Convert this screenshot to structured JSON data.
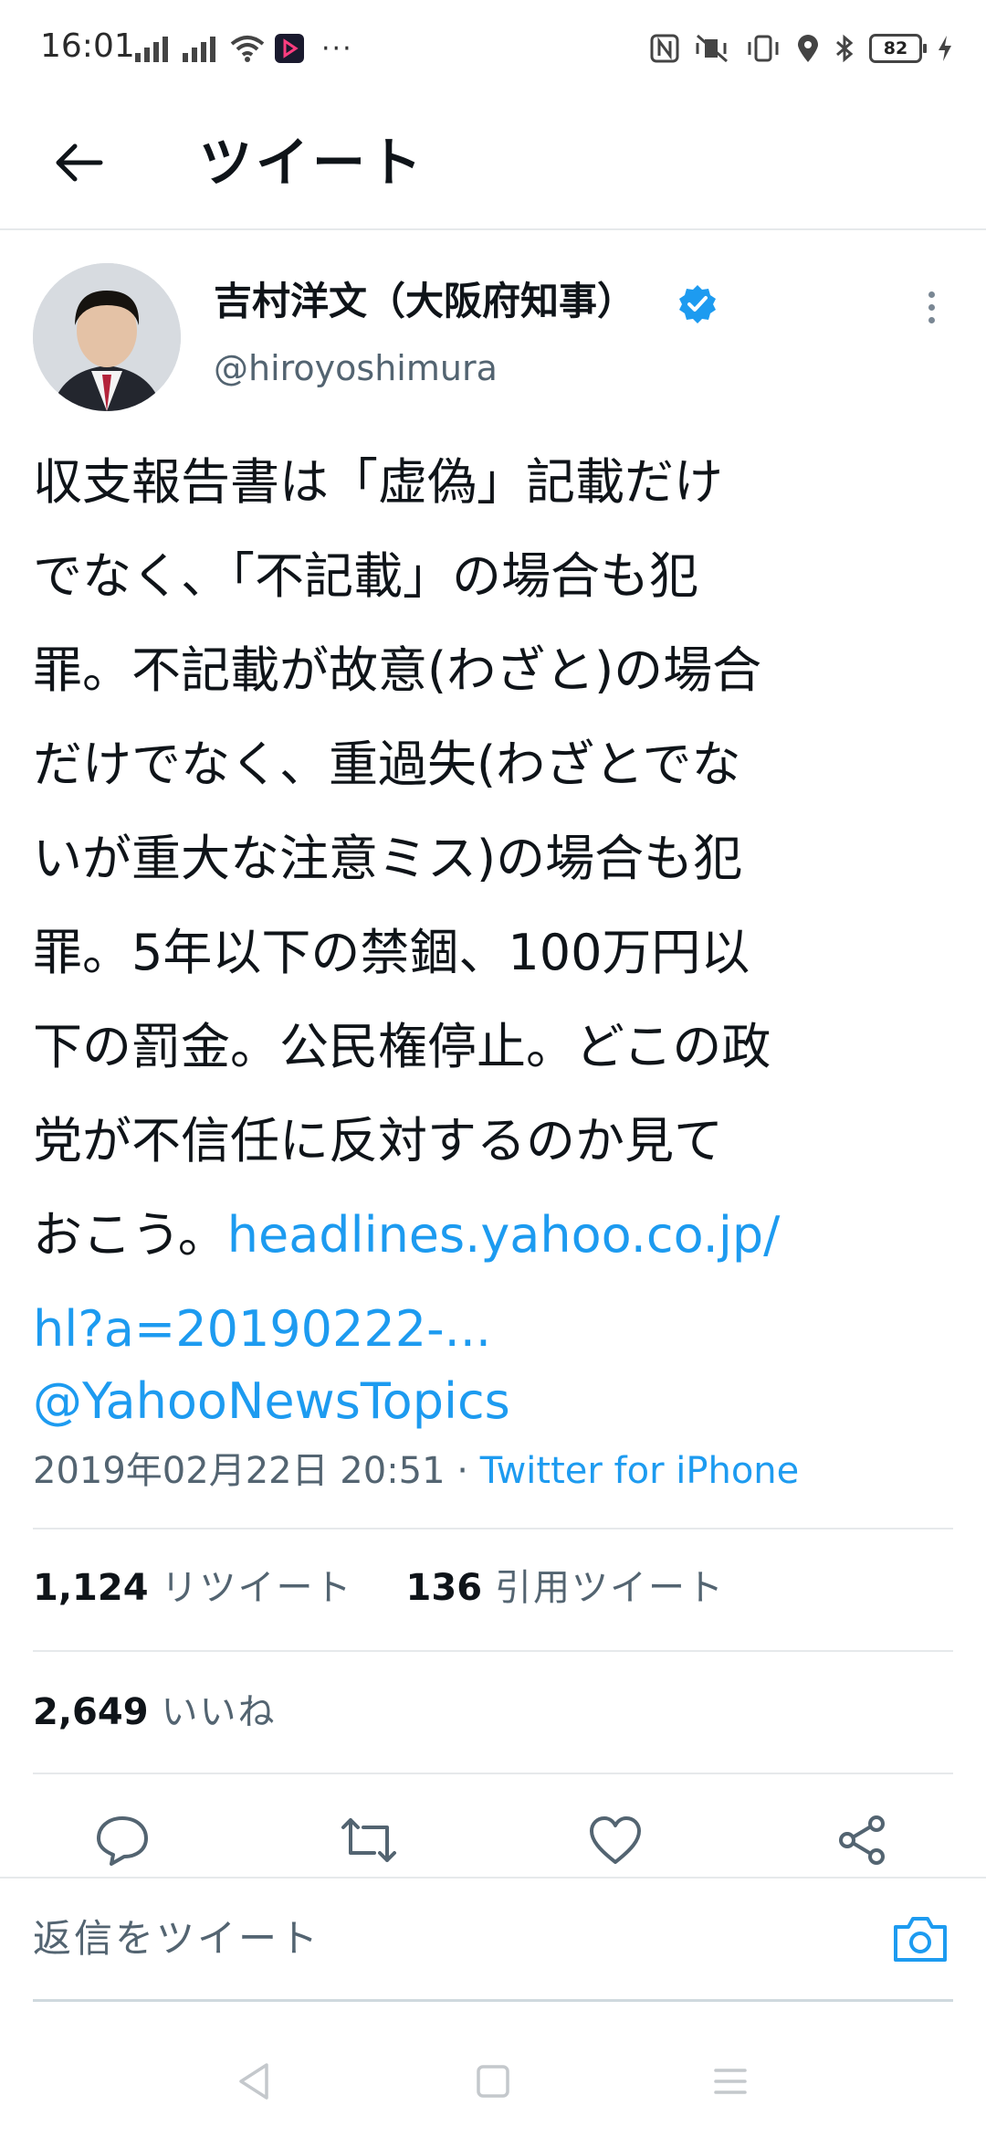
{
  "status_bar": {
    "time": "16:01",
    "battery": "82",
    "overflow": "···",
    "icons": [
      "signal-icon",
      "signal-icon",
      "wifi-icon",
      "app-notification-icon",
      "nfc-icon",
      "vibrate-off-icon",
      "vibrate-icon",
      "location-icon",
      "bluetooth-icon",
      "battery-icon",
      "charging-icon"
    ]
  },
  "header": {
    "title": "ツイート",
    "back_icon": "arrow-left-icon"
  },
  "tweet": {
    "author": {
      "name": "吉村洋文（大阪府知事）",
      "handle": "@hiroyoshimura",
      "verified": true
    },
    "text": "収支報告書は「虚偽」記載だけ\nでなく、「不記載」の場合も犯\n罪。不記載が故意(わざと)の場合\nだけでなく、重過失(わざとでな\nいが重大な注意ミス)の場合も犯\n罪。5年以下の禁錮、100万円以\n下の罰金。公民権停止。どこの政\n党が不信任に反対するのか見て\nおこう。",
    "link_line1": "headlines.yahoo.co.jp/",
    "link_line2": "hl?a=20190222-...",
    "mention": "@YahooNewsTopics",
    "timestamp": "2019年02月22日 20:51",
    "separator": " · ",
    "source": "Twitter for iPhone"
  },
  "stats": {
    "retweets": "1,124",
    "retweets_label": "リツイート",
    "quotes": "136",
    "quotes_label": "引用ツイート",
    "likes": "2,649",
    "likes_label": "いいね"
  },
  "actions": [
    "reply-icon",
    "retweet-icon",
    "like-icon",
    "share-icon"
  ],
  "reply": {
    "placeholder": "返信をツイート",
    "camera_icon": "camera-icon"
  },
  "colors": {
    "accent": "#1d9bf0",
    "text": "#0f1419",
    "secondary": "#536471",
    "divider": "#e6e9eb"
  }
}
